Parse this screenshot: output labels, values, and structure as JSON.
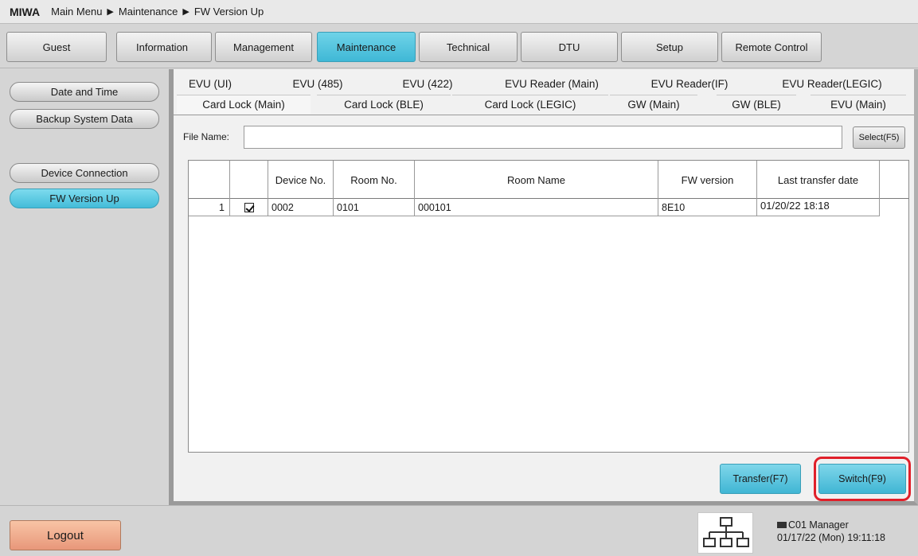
{
  "titlebar": {
    "brand": "MIWA",
    "breadcrumb": [
      "Main Menu",
      "Maintenance",
      "FW Version Up"
    ]
  },
  "topmenu": {
    "items": [
      "Guest",
      "Information",
      "Management",
      "Maintenance",
      "Technical",
      "DTU",
      "Setup",
      "Remote Control"
    ],
    "active": "Maintenance"
  },
  "sidebar": {
    "items": [
      "Date and Time",
      "Backup System Data",
      "Device Connection",
      "FW Version Up"
    ],
    "active": "FW Version Up"
  },
  "tabs": {
    "row1": [
      "EVU (UI)",
      "EVU (485)",
      "EVU (422)",
      "EVU Reader (Main)",
      "EVU Reader(IF)",
      "EVU Reader(LEGIC)"
    ],
    "row2": [
      "Card Lock (Main)",
      "Card Lock (BLE)",
      "Card Lock (LEGIC)",
      "GW (Main)",
      "GW (BLE)",
      "EVU (Main)"
    ],
    "active": "Card Lock (Main)"
  },
  "file": {
    "label": "File Name:",
    "value": "",
    "select_label": "Select(F5)"
  },
  "grid": {
    "headers": [
      "",
      "",
      "Device No.",
      "Room No.",
      "Room Name",
      "FW version",
      "Last transfer date"
    ],
    "rows": [
      {
        "index": "1",
        "checked": true,
        "device_no": "0002",
        "room_no": "0101",
        "room_name": "000101",
        "fw_version": "8E10",
        "last_transfer": "01/20/22 18:18"
      }
    ]
  },
  "actions": {
    "transfer_label": "Transfer(F7)",
    "switch_label": "Switch(F9)"
  },
  "footer": {
    "logout_label": "Logout",
    "user": "C01 Manager",
    "datetime": "01/17/22 (Mon) 19:11:18"
  },
  "colors": {
    "accent": "#43bcd9",
    "logout": "#e8977a",
    "highlight": "#e0202a"
  }
}
